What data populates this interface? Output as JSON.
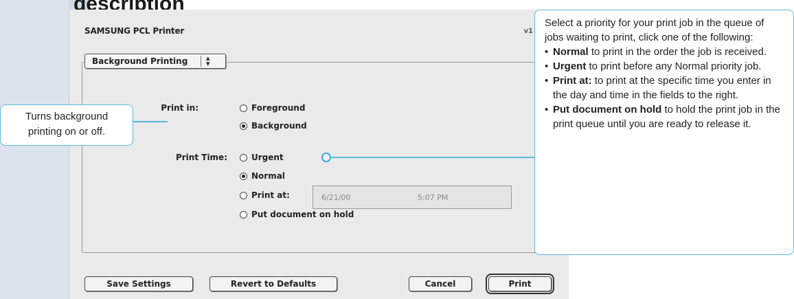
{
  "page": {
    "heading": "Option description"
  },
  "dialog": {
    "title": "SAMSUNG PCL Printer",
    "version": "v1",
    "panel_popup": {
      "selected": "Background Printing"
    },
    "print_in": {
      "label": "Print in:",
      "options": [
        {
          "label": "Foreground",
          "selected": false
        },
        {
          "label": "Background",
          "selected": true
        }
      ]
    },
    "print_time": {
      "label": "Print Time:",
      "options": [
        {
          "label": "Urgent",
          "selected": false
        },
        {
          "label": "Normal",
          "selected": true
        },
        {
          "label": "Print at:",
          "selected": false
        },
        {
          "label": "Put document on hold",
          "selected": false
        }
      ],
      "date_value": "6/21/00",
      "time_value": "5:07 PM"
    },
    "buttons": {
      "save": "Save Settings",
      "revert": "Revert to Defaults",
      "cancel": "Cancel",
      "print": "Print"
    }
  },
  "callouts": {
    "left": {
      "line1": "Turns background",
      "line2": "printing on or off."
    },
    "right": {
      "intro": "Select a priority for your print job in the queue of jobs waiting to print, click one of the following:",
      "items": [
        {
          "term": "Normal",
          "text": " to print in the order the job is received."
        },
        {
          "term": "Urgent",
          "text": " to print before any Normal priority job."
        },
        {
          "term": "Print at:",
          "text": " to print at the specific time you enter in the day and time in the fields to the right."
        },
        {
          "term": "Put document on hold",
          "text": " to hold the print job in the print queue until you are ready to release it."
        }
      ]
    }
  },
  "colors": {
    "callout_border": "#5cb8dd",
    "page_tab": "#cfdae3",
    "dialog_bg": "#eaeaea"
  }
}
